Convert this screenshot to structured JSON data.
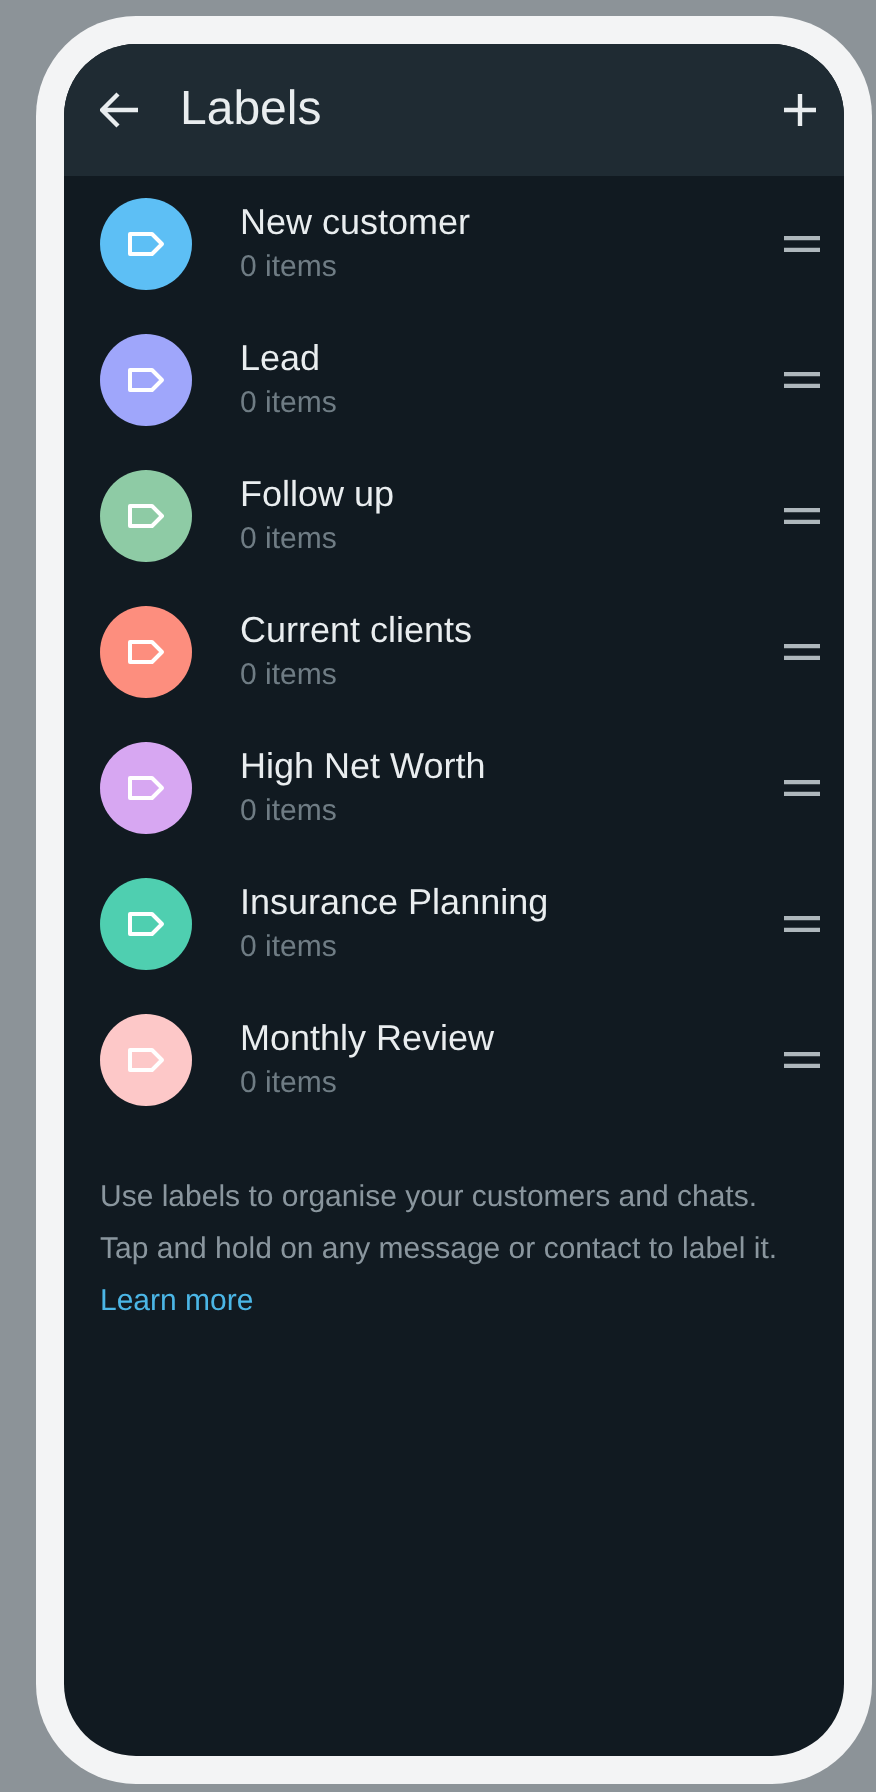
{
  "header": {
    "title": "Labels"
  },
  "labels": [
    {
      "name": "New customer",
      "count": "0 items",
      "color": "#5dbff5"
    },
    {
      "name": "Lead",
      "count": "0 items",
      "color": "#9fa6fb"
    },
    {
      "name": "Follow up",
      "count": "0 items",
      "color": "#8ecba5"
    },
    {
      "name": "Current clients",
      "count": "0 items",
      "color": "#fd8e7e"
    },
    {
      "name": "High Net Worth",
      "count": "0 items",
      "color": "#d7a7f2"
    },
    {
      "name": "Insurance Planning",
      "count": "0 items",
      "color": "#4fcfb0"
    },
    {
      "name": "Monthly Review",
      "count": "0 items",
      "color": "#fdc8c8"
    }
  ],
  "footer": {
    "text": "Use labels to organise your customers and chats. Tap and hold on any message or contact to label it.",
    "link": "Learn more"
  }
}
